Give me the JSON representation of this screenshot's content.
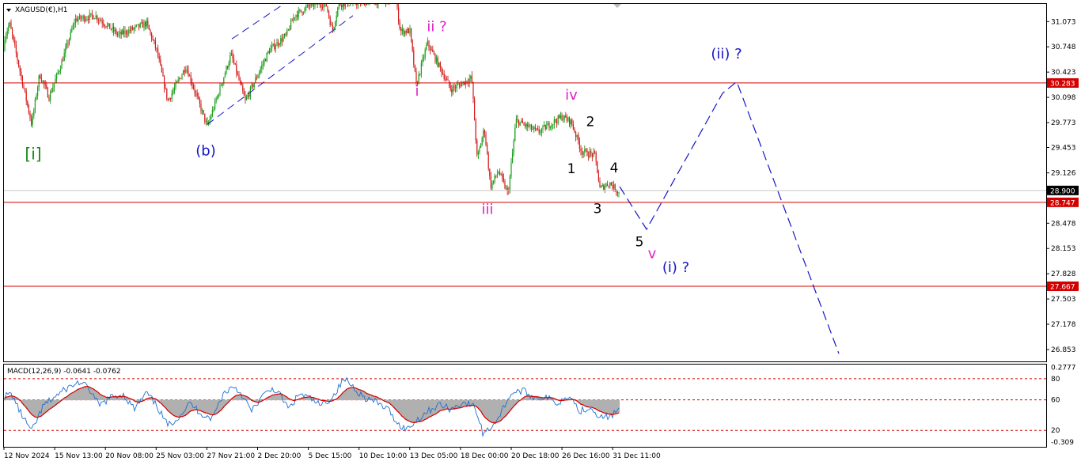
{
  "header": {
    "symbol": "XAGUSD(€),H1",
    "macd_label": "MACD(12,26,9) -0.0641 -0.0762"
  },
  "colors": {
    "bull": "#1a9e1a",
    "bear": "#d41c1c",
    "line": "#d40000",
    "wave_blue": "#1515c8",
    "magenta": "#e020c8",
    "green": "#138a13",
    "macd_main": "#1e6fd0",
    "macd_signal": "#d40000",
    "macd_hist": "#b0b0b0",
    "badge": "#d40000",
    "current_badge": "#000000"
  },
  "chart_data": [
    {
      "type": "candlestick",
      "title": "XAGUSD(€),H1",
      "ylim": [
        26.7,
        31.3
      ],
      "y_ticks": [
        "31.073",
        "30.748",
        "30.423",
        "30.098",
        "29.773",
        "29.453",
        "29.126",
        "28.478",
        "28.153",
        "27.828",
        "27.503",
        "27.178",
        "26.853"
      ],
      "x_ticks": [
        "12 Nov 2024",
        "15 Nov 13:00",
        "20 Nov 08:00",
        "25 Nov 03:00",
        "27 Nov 21:00",
        "2 Dec 20:00",
        "5 Dec 15:00",
        "10 Dec 10:00",
        "13 Dec 05:00",
        "18 Dec 00:00",
        "20 Dec 18:00",
        "26 Dec 16:00",
        "31 Dec 11:00"
      ],
      "path_anchors": [
        [
          0,
          30.7
        ],
        [
          12,
          31.05
        ],
        [
          40,
          29.75
        ],
        [
          50,
          30.4
        ],
        [
          62,
          30.1
        ],
        [
          78,
          30.55
        ],
        [
          95,
          31.1
        ],
        [
          120,
          31.15
        ],
        [
          150,
          30.9
        ],
        [
          185,
          31.05
        ],
        [
          198,
          30.7
        ],
        [
          212,
          30.05
        ],
        [
          235,
          30.5
        ],
        [
          262,
          29.72
        ],
        [
          292,
          30.65
        ],
        [
          310,
          30.05
        ],
        [
          340,
          30.7
        ],
        [
          362,
          30.9
        ],
        [
          372,
          31.15
        ],
        [
          395,
          31.3
        ],
        [
          412,
          31.3
        ],
        [
          420,
          30.95
        ],
        [
          428,
          31.3
        ],
        [
          500,
          31.35
        ],
        [
          506,
          30.95
        ],
        [
          518,
          30.95
        ],
        [
          526,
          30.25
        ],
        [
          540,
          30.8
        ],
        [
          570,
          30.2
        ],
        [
          596,
          30.35
        ],
        [
          603,
          29.3
        ],
        [
          612,
          29.7
        ],
        [
          620,
          28.95
        ],
        [
          630,
          29.15
        ],
        [
          642,
          28.85
        ],
        [
          652,
          29.8
        ],
        [
          680,
          29.65
        ],
        [
          710,
          29.85
        ],
        [
          722,
          29.78
        ],
        [
          735,
          29.4
        ],
        [
          752,
          29.35
        ],
        [
          758,
          28.92
        ],
        [
          770,
          29.0
        ],
        [
          783,
          28.86
        ]
      ],
      "price_lines": [
        {
          "value": 30.283,
          "label": "30.283"
        },
        {
          "value": 28.747,
          "label": "28.747"
        },
        {
          "value": 27.667,
          "label": "27.667"
        }
      ],
      "current_price": {
        "value": 28.9,
        "label": "28.900"
      },
      "channel_lines": [
        {
          "points": [
            [
              293,
              30.85
            ],
            [
              366,
              31.35
            ]
          ]
        },
        {
          "points": [
            [
              262,
              29.75
            ],
            [
              446,
              31.15
            ]
          ]
        }
      ],
      "projection": {
        "points": [
          [
            783,
            28.95
          ],
          [
            817,
            28.4
          ],
          [
            913,
            30.15
          ],
          [
            931,
            30.3
          ],
          [
            1060,
            26.8
          ]
        ]
      },
      "wave_labels": [
        {
          "text": "[i]",
          "x": 42,
          "y": 29.3,
          "color": "green",
          "size": 20
        },
        {
          "text": "(b)",
          "x": 260,
          "y": 29.35,
          "color": "wave_blue",
          "size": 18
        },
        {
          "text": "ii ?",
          "x": 552,
          "y": 30.95,
          "color": "magenta",
          "size": 18
        },
        {
          "text": "i",
          "x": 527,
          "y": 30.12,
          "color": "magenta",
          "size": 18
        },
        {
          "text": "iv",
          "x": 722,
          "y": 30.07,
          "color": "magenta",
          "size": 18
        },
        {
          "text": "iii",
          "x": 616,
          "y": 28.6,
          "color": "magenta",
          "size": 18
        },
        {
          "text": "2",
          "x": 746,
          "y": 29.73,
          "color": "black",
          "size": 17
        },
        {
          "text": "1",
          "x": 722,
          "y": 29.12,
          "color": "black",
          "size": 17
        },
        {
          "text": "4",
          "x": 776,
          "y": 29.13,
          "color": "black",
          "size": 17
        },
        {
          "text": "3",
          "x": 755,
          "y": 28.61,
          "color": "black",
          "size": 17
        },
        {
          "text": "5",
          "x": 808,
          "y": 28.18,
          "color": "black",
          "size": 17
        },
        {
          "text": "v",
          "x": 824,
          "y": 28.03,
          "color": "magenta",
          "size": 18
        },
        {
          "text": "(i) ?",
          "x": 854,
          "y": 27.85,
          "color": "wave_blue",
          "size": 18
        },
        {
          "text": "(ii) ?",
          "x": 918,
          "y": 30.6,
          "color": "wave_blue",
          "size": 18
        }
      ]
    },
    {
      "type": "macd",
      "title": "MACD(12,26,9) -0.0641 -0.0762",
      "ylim": [
        -0.4,
        0.3
      ],
      "y_ticks": [
        "0.2777",
        "80",
        "60",
        "20",
        "-0.309"
      ],
      "levels": [
        0.18,
        0.0,
        -0.26
      ],
      "main_anchors": [
        [
          0,
          0.02
        ],
        [
          15,
          0.05
        ],
        [
          25,
          -0.1
        ],
        [
          40,
          -0.27
        ],
        [
          55,
          -0.05
        ],
        [
          70,
          0.03
        ],
        [
          85,
          0.1
        ],
        [
          100,
          0.15
        ],
        [
          112,
          0.1
        ],
        [
          125,
          -0.05
        ],
        [
          140,
          0.02
        ],
        [
          155,
          0.05
        ],
        [
          170,
          -0.08
        ],
        [
          185,
          0.06
        ],
        [
          198,
          -0.05
        ],
        [
          212,
          -0.22
        ],
        [
          225,
          -0.15
        ],
        [
          240,
          -0.03
        ],
        [
          255,
          -0.12
        ],
        [
          268,
          -0.16
        ],
        [
          282,
          0.05
        ],
        [
          295,
          0.12
        ],
        [
          305,
          0.05
        ],
        [
          318,
          -0.1
        ],
        [
          330,
          0.02
        ],
        [
          345,
          0.1
        ],
        [
          355,
          0.03
        ],
        [
          365,
          -0.08
        ],
        [
          378,
          0.05
        ],
        [
          390,
          0.02
        ],
        [
          405,
          -0.05
        ],
        [
          420,
          0.02
        ],
        [
          435,
          0.18
        ],
        [
          445,
          0.12
        ],
        [
          460,
          0.02
        ],
        [
          475,
          -0.02
        ],
        [
          490,
          -0.08
        ],
        [
          505,
          -0.22
        ],
        [
          515,
          -0.25
        ],
        [
          525,
          -0.18
        ],
        [
          540,
          -0.1
        ],
        [
          555,
          -0.04
        ],
        [
          570,
          -0.08
        ],
        [
          585,
          -0.02
        ],
        [
          600,
          -0.06
        ],
        [
          610,
          -0.28
        ],
        [
          618,
          -0.25
        ],
        [
          630,
          -0.15
        ],
        [
          645,
          0.05
        ],
        [
          660,
          0.08
        ],
        [
          675,
          0.02
        ],
        [
          690,
          0.02
        ],
        [
          705,
          -0.03
        ],
        [
          720,
          0.05
        ],
        [
          732,
          -0.1
        ],
        [
          745,
          -0.06
        ],
        [
          760,
          -0.15
        ],
        [
          772,
          -0.14
        ],
        [
          783,
          -0.07
        ]
      ]
    }
  ]
}
